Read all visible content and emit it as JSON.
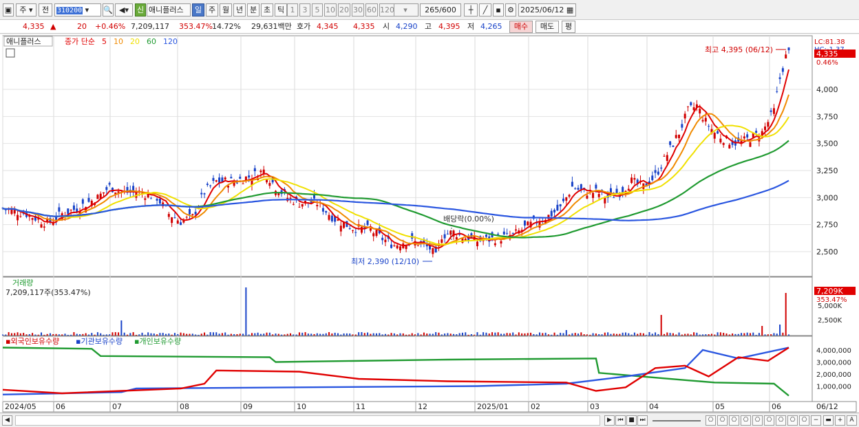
{
  "toolbar": {
    "type1": "주",
    "type2": "전",
    "code": "310200",
    "name": "애니플러스",
    "sin": "신",
    "periods": [
      "일",
      "주",
      "월",
      "년",
      "분",
      "초",
      "틱"
    ],
    "intervals": [
      "1",
      "3",
      "5",
      "10",
      "20",
      "30",
      "60",
      "120"
    ],
    "count": "265",
    "count_max": "/600",
    "date": "2025/06/12"
  },
  "quote": {
    "price": "4,335",
    "change_arrow": "▲",
    "change": "20",
    "change_pct": "+0.46%",
    "volume": "7,209,117",
    "vol_ratio": "353.47%",
    "turnover": "14.72%",
    "amount": "29,631백만",
    "bid_label": "호가",
    "bid1": "4,345",
    "bid2": "4,335",
    "open_label": "시",
    "open": "4,290",
    "high_label": "고",
    "high": "4,395",
    "low_label": "저",
    "low": "4,265",
    "buy": "매수",
    "sell": "매도",
    "eval": "평"
  },
  "price_panel": {
    "name": "애니플러스",
    "ma_label": "종가 단순",
    "ma_periods": [
      "5",
      "10",
      "20",
      "60",
      "120"
    ],
    "lc": "LC:81.38",
    "hc": "HC:-1.37",
    "current": "4,335",
    "current_pct": "0.46%",
    "high_note": "최고 4,395 (06/12)",
    "low_note": "최저 2,390 (12/10)",
    "div_note": "배당락(0.00%)",
    "yticks": [
      "4,000",
      "3,750",
      "3,500",
      "3,250",
      "3,000",
      "2,750",
      "2,500"
    ]
  },
  "volume_panel": {
    "title": "거래량",
    "value": "7,209,117주(353.47%)",
    "current": "7,209K",
    "current_pct": "353.47%",
    "yticks": [
      "5,000K",
      "2,500K"
    ]
  },
  "holdings_panel": {
    "series": [
      "외국인보유수량",
      "기관보유수량",
      "개인보유수량"
    ],
    "yticks": [
      "4,000,000",
      "3,000,000",
      "2,000,000",
      "1,000,000"
    ]
  },
  "xaxis": [
    "2024/05",
    "06",
    "07",
    "08",
    "09",
    "10",
    "11",
    "12",
    "2025/01",
    "02",
    "03",
    "04",
    "05",
    "06"
  ],
  "xaxis_right": "06/12",
  "colors": {
    "up": "#d10000",
    "down": "#1842c8",
    "ma5": "#e00000",
    "ma10": "#f08a00",
    "ma20": "#f0e000",
    "ma60": "#1f9a30",
    "ma120": "#2a56e0",
    "foreign": "#e00000",
    "inst": "#2a56e0",
    "indiv": "#1f9a30"
  },
  "chart_data": {
    "type": "candlestick",
    "x_range": [
      "2024/05",
      "2025/06/12"
    ],
    "ylim": [
      2390,
      4395
    ],
    "high": {
      "value": 4395,
      "date": "06/12"
    },
    "low": {
      "value": 2390,
      "date": "12/10"
    },
    "holdings_ylim": [
      0,
      4400000
    ]
  }
}
